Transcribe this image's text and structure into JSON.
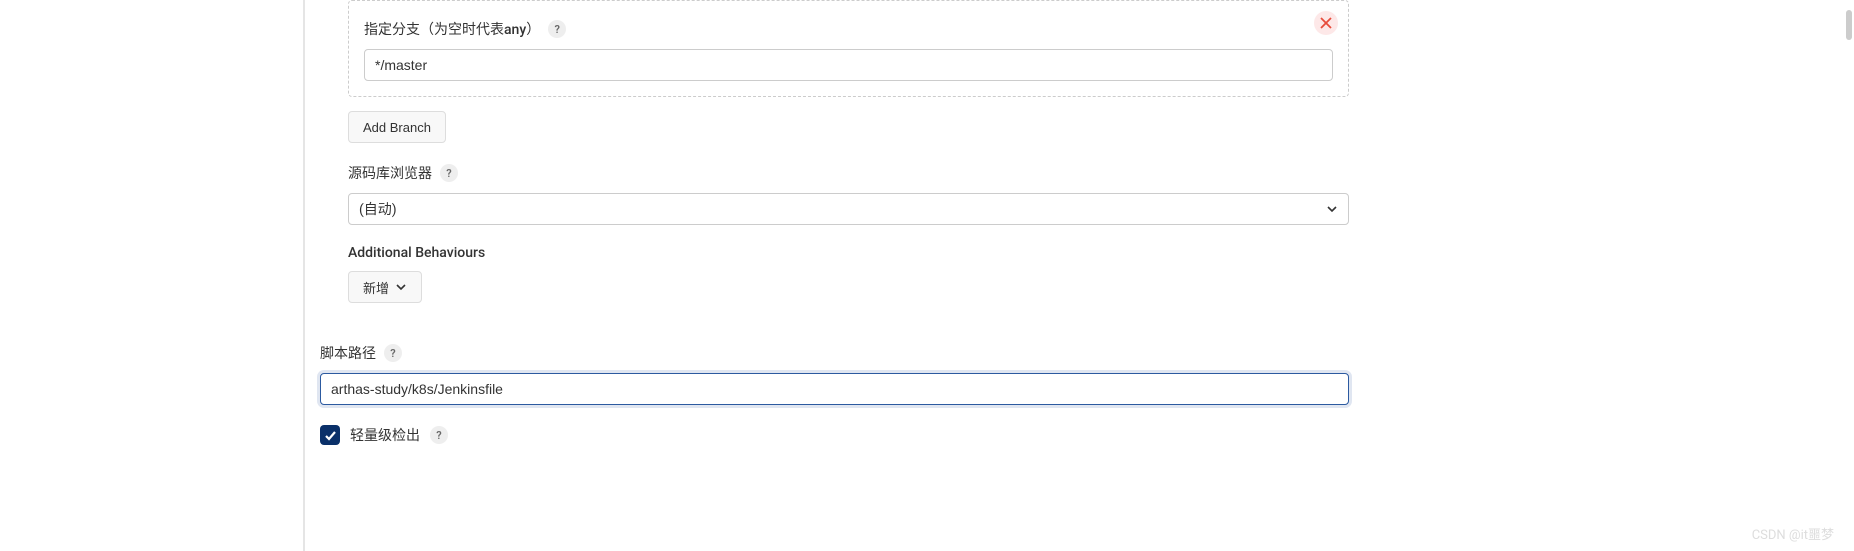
{
  "branch_section": {
    "label": "指定分支（为空时代表any）",
    "input_value": "*/master"
  },
  "add_branch_button": "Add Branch",
  "scm_browser": {
    "label": "源码库浏览器",
    "selected": "(自动)"
  },
  "additional_behaviours": {
    "label": "Additional Behaviours",
    "add_button": "新增"
  },
  "script_path": {
    "label": "脚本路径",
    "value": "arthas-study/k8s/Jenkinsfile"
  },
  "lightweight_checkout": {
    "label": "轻量级检出",
    "checked": true
  },
  "help_tooltip": "?",
  "watermark": "CSDN @it噩梦"
}
